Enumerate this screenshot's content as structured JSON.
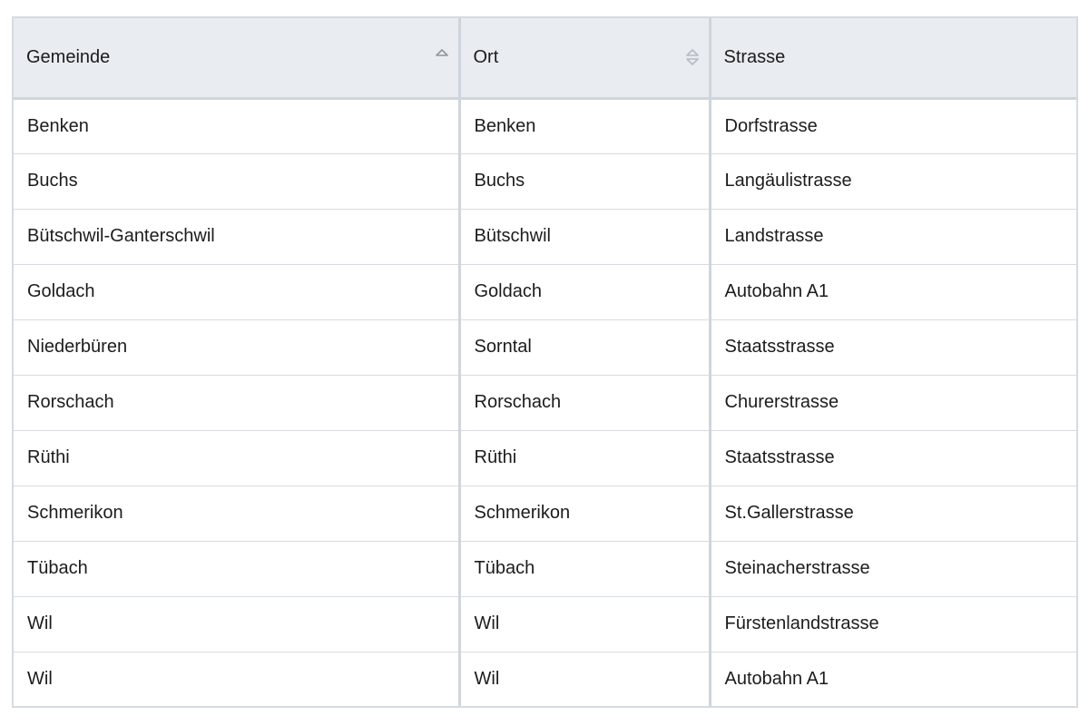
{
  "table": {
    "columns": [
      {
        "label": "Gemeinde",
        "sort": "ascending",
        "sort_icon": "sort-ascending-icon"
      },
      {
        "label": "Ort",
        "sort": "none",
        "sort_icon": "sort-both-icon"
      },
      {
        "label": "Strasse",
        "sort": "unsortable"
      }
    ],
    "rows": [
      [
        "Benken",
        "Benken",
        "Dorfstrasse"
      ],
      [
        "Buchs",
        "Buchs",
        "Langäulistrasse"
      ],
      [
        "Bütschwil-Ganterschwil",
        "Bütschwil",
        "Landstrasse"
      ],
      [
        "Goldach",
        "Goldach",
        "Autobahn A1"
      ],
      [
        "Niederbüren",
        "Sorntal",
        "Staatsstrasse"
      ],
      [
        "Rorschach",
        "Rorschach",
        "Churerstrasse"
      ],
      [
        "Rüthi",
        "Rüthi",
        "Staatsstrasse"
      ],
      [
        "Schmerikon",
        "Schmerikon",
        "St.Gallerstrasse"
      ],
      [
        "Tübach",
        "Tübach",
        "Steinacherstrasse"
      ],
      [
        "Wil",
        "Wil",
        "Fürstenlandstrasse"
      ],
      [
        "Wil",
        "Wil",
        "Autobahn A1"
      ]
    ]
  },
  "colors": {
    "header_bg": "#e9ecf0",
    "border": "#cfd5dc",
    "icon": "#9aa3ad"
  }
}
